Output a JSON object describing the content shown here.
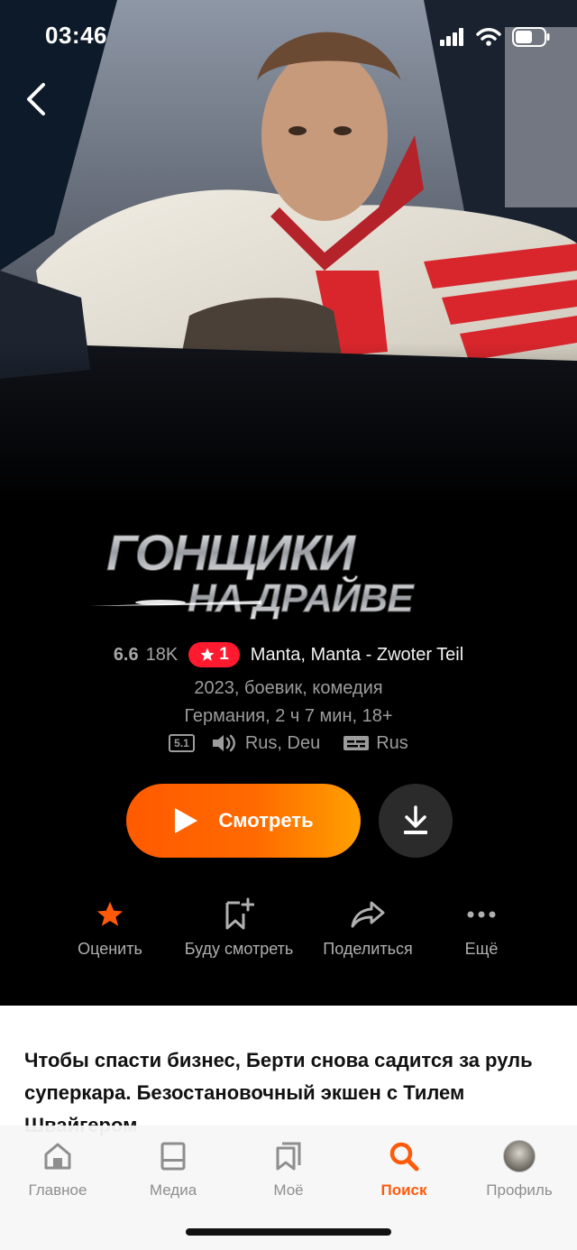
{
  "status": {
    "time": "03:46"
  },
  "movie": {
    "logo_line1": "ГОНЩИКИ",
    "logo_line2": "НА ДРАЙВЕ",
    "rating": "6.6",
    "votes": "18K",
    "top_badge": "1",
    "original_title": "Manta, Manta - Zwoter Teil",
    "year_genres": "2023, боевик, комедия",
    "country_duration_age": "Германия, 2 ч 7 мин, 18+",
    "sound_format": "5.1",
    "audio_languages": "Rus, Deu",
    "subtitles": "Rus",
    "description": "Чтобы спасти бизнес, Берти снова садится за руль суперкара. Безостановочный экшен с Тилем Швайгером"
  },
  "buttons": {
    "watch": "Смотреть"
  },
  "actions": [
    {
      "label": "Оценить",
      "icon": "star-icon"
    },
    {
      "label": "Буду смотреть",
      "icon": "bookmark-plus-icon"
    },
    {
      "label": "Поделиться",
      "icon": "share-icon"
    },
    {
      "label": "Ещё",
      "icon": "more-icon"
    }
  ],
  "tabs": [
    {
      "label": "Главное",
      "icon": "home-icon"
    },
    {
      "label": "Медиа",
      "icon": "media-icon"
    },
    {
      "label": "Моё",
      "icon": "my-icon"
    },
    {
      "label": "Поиск",
      "icon": "search-icon",
      "active": true
    },
    {
      "label": "Профиль",
      "icon": "profile-avatar"
    }
  ],
  "colors": {
    "accent": "#ff5a0a",
    "badge": "#ff1a2f"
  }
}
